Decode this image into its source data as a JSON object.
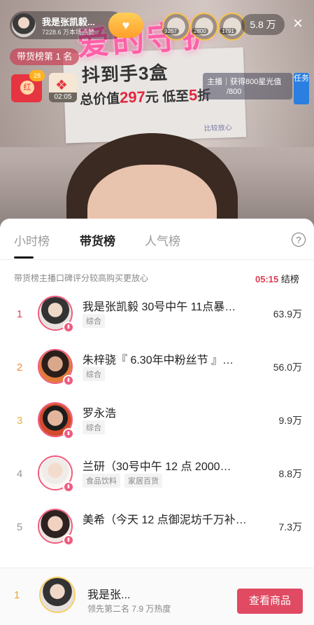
{
  "stream": {
    "host_name": "我是张凯毅...",
    "host_sub": "7228.6 万本场点赞",
    "viewer_counts": [
      "9267",
      "2800",
      "1791"
    ],
    "viewer_total": "5.8 万",
    "rank_tag": "带货榜第 1 名",
    "redpack_badge": "28",
    "redpack_icon": "红",
    "gift_timer": "02:05",
    "task_line1": "主播｜获得800星光值",
    "task_line2": "/800",
    "task_side": "任务",
    "neon_text": "爱的守护",
    "sign_line1": "抖到手3盒",
    "sign_line2_prefix": "总价值",
    "sign_line2_price": "297",
    "sign_line2_mid": "元 低至",
    "sign_line2_disc": "5",
    "sign_line2_suffix": "折",
    "sign_line3": "比较放心",
    "close_icon": "×"
  },
  "panel": {
    "tabs": [
      {
        "label": "小时榜"
      },
      {
        "label": "带货榜"
      },
      {
        "label": "人气榜"
      }
    ],
    "help_icon": "?",
    "description": "带货榜主播口碑评分较高购买更放心",
    "countdown_time": "05:15",
    "countdown_label": "结榜",
    "rows": [
      {
        "rank": "1",
        "title": "我是张凯毅 30号中午 11点暴…",
        "tags": [
          "综合"
        ],
        "heat": "63.9万",
        "rank_color": "#e0475f"
      },
      {
        "rank": "2",
        "title": "朱梓骁『 6.30年中粉丝节 』…",
        "tags": [
          "综合"
        ],
        "heat": "56.0万",
        "rank_color": "#f08a3c"
      },
      {
        "rank": "3",
        "title": "罗永浩",
        "tags": [
          "综合"
        ],
        "heat": "9.9万",
        "rank_color": "#e9b23c"
      },
      {
        "rank": "4",
        "title": "兰研（30号中午 12 点 2000…",
        "tags": [
          "食品饮料",
          "家居百货"
        ],
        "heat": "8.8万",
        "rank_color": "#999999"
      },
      {
        "rank": "5",
        "title": "美希（今天 12 点御泥坊千万补…",
        "tags": [],
        "heat": "7.3万",
        "rank_color": "#999999"
      }
    ],
    "bottom": {
      "rank": "1",
      "name": "我是张...",
      "sub": "领先第二名 7.9 万热度",
      "button": "查看商品"
    }
  }
}
